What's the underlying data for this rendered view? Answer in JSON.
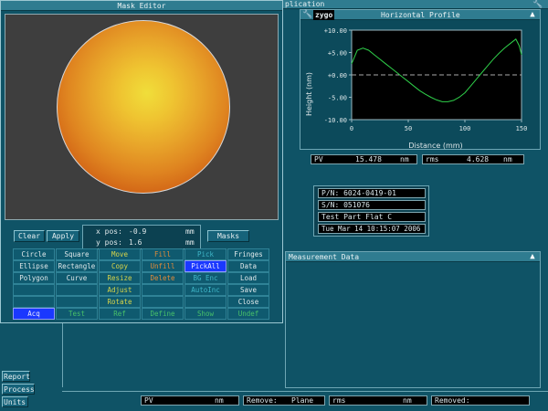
{
  "mask_editor": {
    "title": "Mask Editor",
    "clear": "Clear",
    "apply": "Apply",
    "xpos_label": "x pos:",
    "xpos_value": "-0.9",
    "xpos_unit": "mm",
    "ypos_label": "y pos:",
    "ypos_value": "1.6",
    "ypos_unit": "mm",
    "masks": "Masks",
    "grid": [
      [
        "Circle",
        "Square",
        "Move",
        "Fill",
        "Pick",
        "Fringes"
      ],
      [
        "Ellipse",
        "Rectangle",
        "Copy",
        "Unfill",
        "PickAll",
        "Data"
      ],
      [
        "Polygon",
        "Curve",
        "Resize",
        "Delete",
        "BG Enc",
        "Load"
      ],
      [
        "",
        "",
        "Adjust",
        "",
        "AutoInc",
        "Save"
      ],
      [
        "",
        "",
        "Rotate",
        "",
        "",
        "Close"
      ],
      [
        "Acq",
        "Test",
        "Ref",
        "Define",
        "Show",
        "Undef"
      ]
    ]
  },
  "application": {
    "title_fragment": "plication",
    "logo": "zygo"
  },
  "profile": {
    "title": "Horizontal Profile",
    "ylabel": "Height (nm)",
    "xlabel": "Distance (mm)",
    "pv_label": "PV",
    "pv_value": "15.478",
    "pv_unit": "nm",
    "rms_label": "rms",
    "rms_value": "4.628",
    "rms_unit": "nm"
  },
  "chart_data": {
    "type": "line",
    "xlabel": "Distance (mm)",
    "ylabel": "Height (nm)",
    "xlim": [
      0,
      150
    ],
    "ylim": [
      -10,
      10
    ],
    "x_ticks": [
      "0",
      "50",
      "100",
      "150"
    ],
    "y_ticks": [
      "+10.00",
      "+5.00",
      "+0.00",
      "-5.00",
      "-10.00"
    ],
    "reference_line": 0,
    "series": [
      {
        "x": [
          0,
          5,
          10,
          15,
          20,
          25,
          30,
          35,
          40,
          45,
          50,
          55,
          60,
          65,
          70,
          75,
          80,
          85,
          90,
          95,
          100,
          105,
          110,
          115,
          120,
          125,
          130,
          135,
          140,
          145,
          148,
          150
        ],
        "values": [
          2.5,
          5.5,
          6.0,
          5.5,
          4.5,
          3.5,
          2.5,
          1.5,
          0.5,
          -0.5,
          -1.5,
          -2.5,
          -3.5,
          -4.3,
          -5.0,
          -5.6,
          -6.0,
          -6.0,
          -5.7,
          -5.0,
          -4.0,
          -2.5,
          -1.0,
          0.5,
          2.0,
          3.5,
          4.8,
          6.0,
          7.0,
          8.0,
          6.5,
          4.5
        ]
      }
    ]
  },
  "info": {
    "pn": "P/N: 6024-0419-01",
    "sn": "S/N: 051076",
    "part": "Test Part Flat C",
    "date": "Tue Mar 14 10:15:07 2006"
  },
  "measurement": {
    "title": "Measurement Data"
  },
  "bottom_bar": {
    "pv_label": "PV",
    "pv_unit": "nm",
    "remove_label": "Remove:",
    "remove_value": "Plane",
    "rms_label": "rms",
    "rms_unit": "nm",
    "removed_label": "Removed:"
  },
  "side_buttons": [
    "Report",
    "Process",
    "Units"
  ],
  "colors": {
    "background": "#0f5366",
    "titlebar": "#2f7c90",
    "selected": "#1a38ff",
    "plot_line": "#2fd04a"
  }
}
